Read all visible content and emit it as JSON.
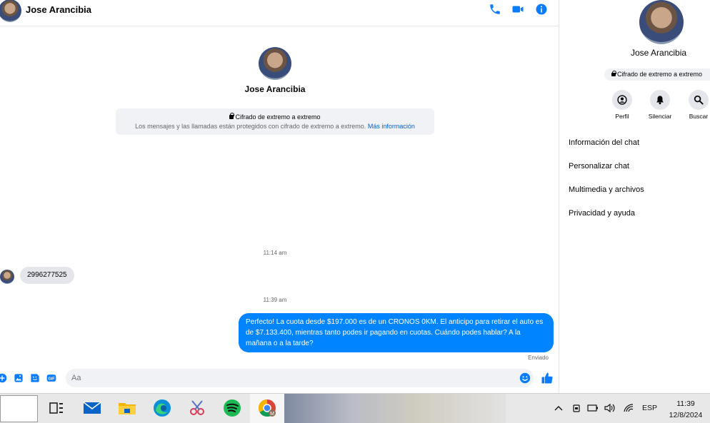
{
  "header": {
    "contact_name": "Jose Arancibia"
  },
  "conversation": {
    "profile_name": "Jose Arancibia",
    "encryption": {
      "title": "Cifrado de extremo a extremo",
      "description": "Los mensajes y las llamadas están protegidos con cifrado de extremo a extremo.",
      "link": "Más información"
    },
    "messages": [
      {
        "timestamp": "11:14 am",
        "direction": "incoming",
        "text": "2996277525"
      },
      {
        "timestamp": "11:39 am",
        "direction": "outgoing",
        "text": "Perfecto! La cuota desde $197.000 es de un CRONOS 0KM. El anticipo para retirar el auto es de $7.133.400, mientras tanto podes ir pagando en cuotas. Cuándo podes hablar? A la mañana o a la tarde?",
        "status": "Enviado"
      }
    ]
  },
  "composer": {
    "placeholder": "Aa"
  },
  "panel": {
    "name": "Jose Arancibia",
    "encryption_badge": "Cifrado de extremo a extremo",
    "actions": [
      {
        "label": "Perfil",
        "icon": "profile-icon"
      },
      {
        "label": "Silenciar",
        "icon": "bell-icon"
      },
      {
        "label": "Buscar",
        "icon": "search-icon"
      }
    ],
    "menu": [
      "Información del chat",
      "Personalizar chat",
      "Multimedia y archivos",
      "Privacidad y ayuda"
    ]
  },
  "taskbar": {
    "apps": [
      "task-view-icon",
      "mail-icon",
      "file-explorer-icon",
      "edge-icon",
      "snipping-tool-icon",
      "spotify-icon",
      "chrome-icon"
    ],
    "language": "ESP",
    "time": "11:39",
    "date": "12/8/2024"
  },
  "colors": {
    "accent": "#0084ff",
    "icon_blue": "#0a7cff",
    "bubble_incoming": "#e4e6eb",
    "spotify_green": "#1db954"
  }
}
